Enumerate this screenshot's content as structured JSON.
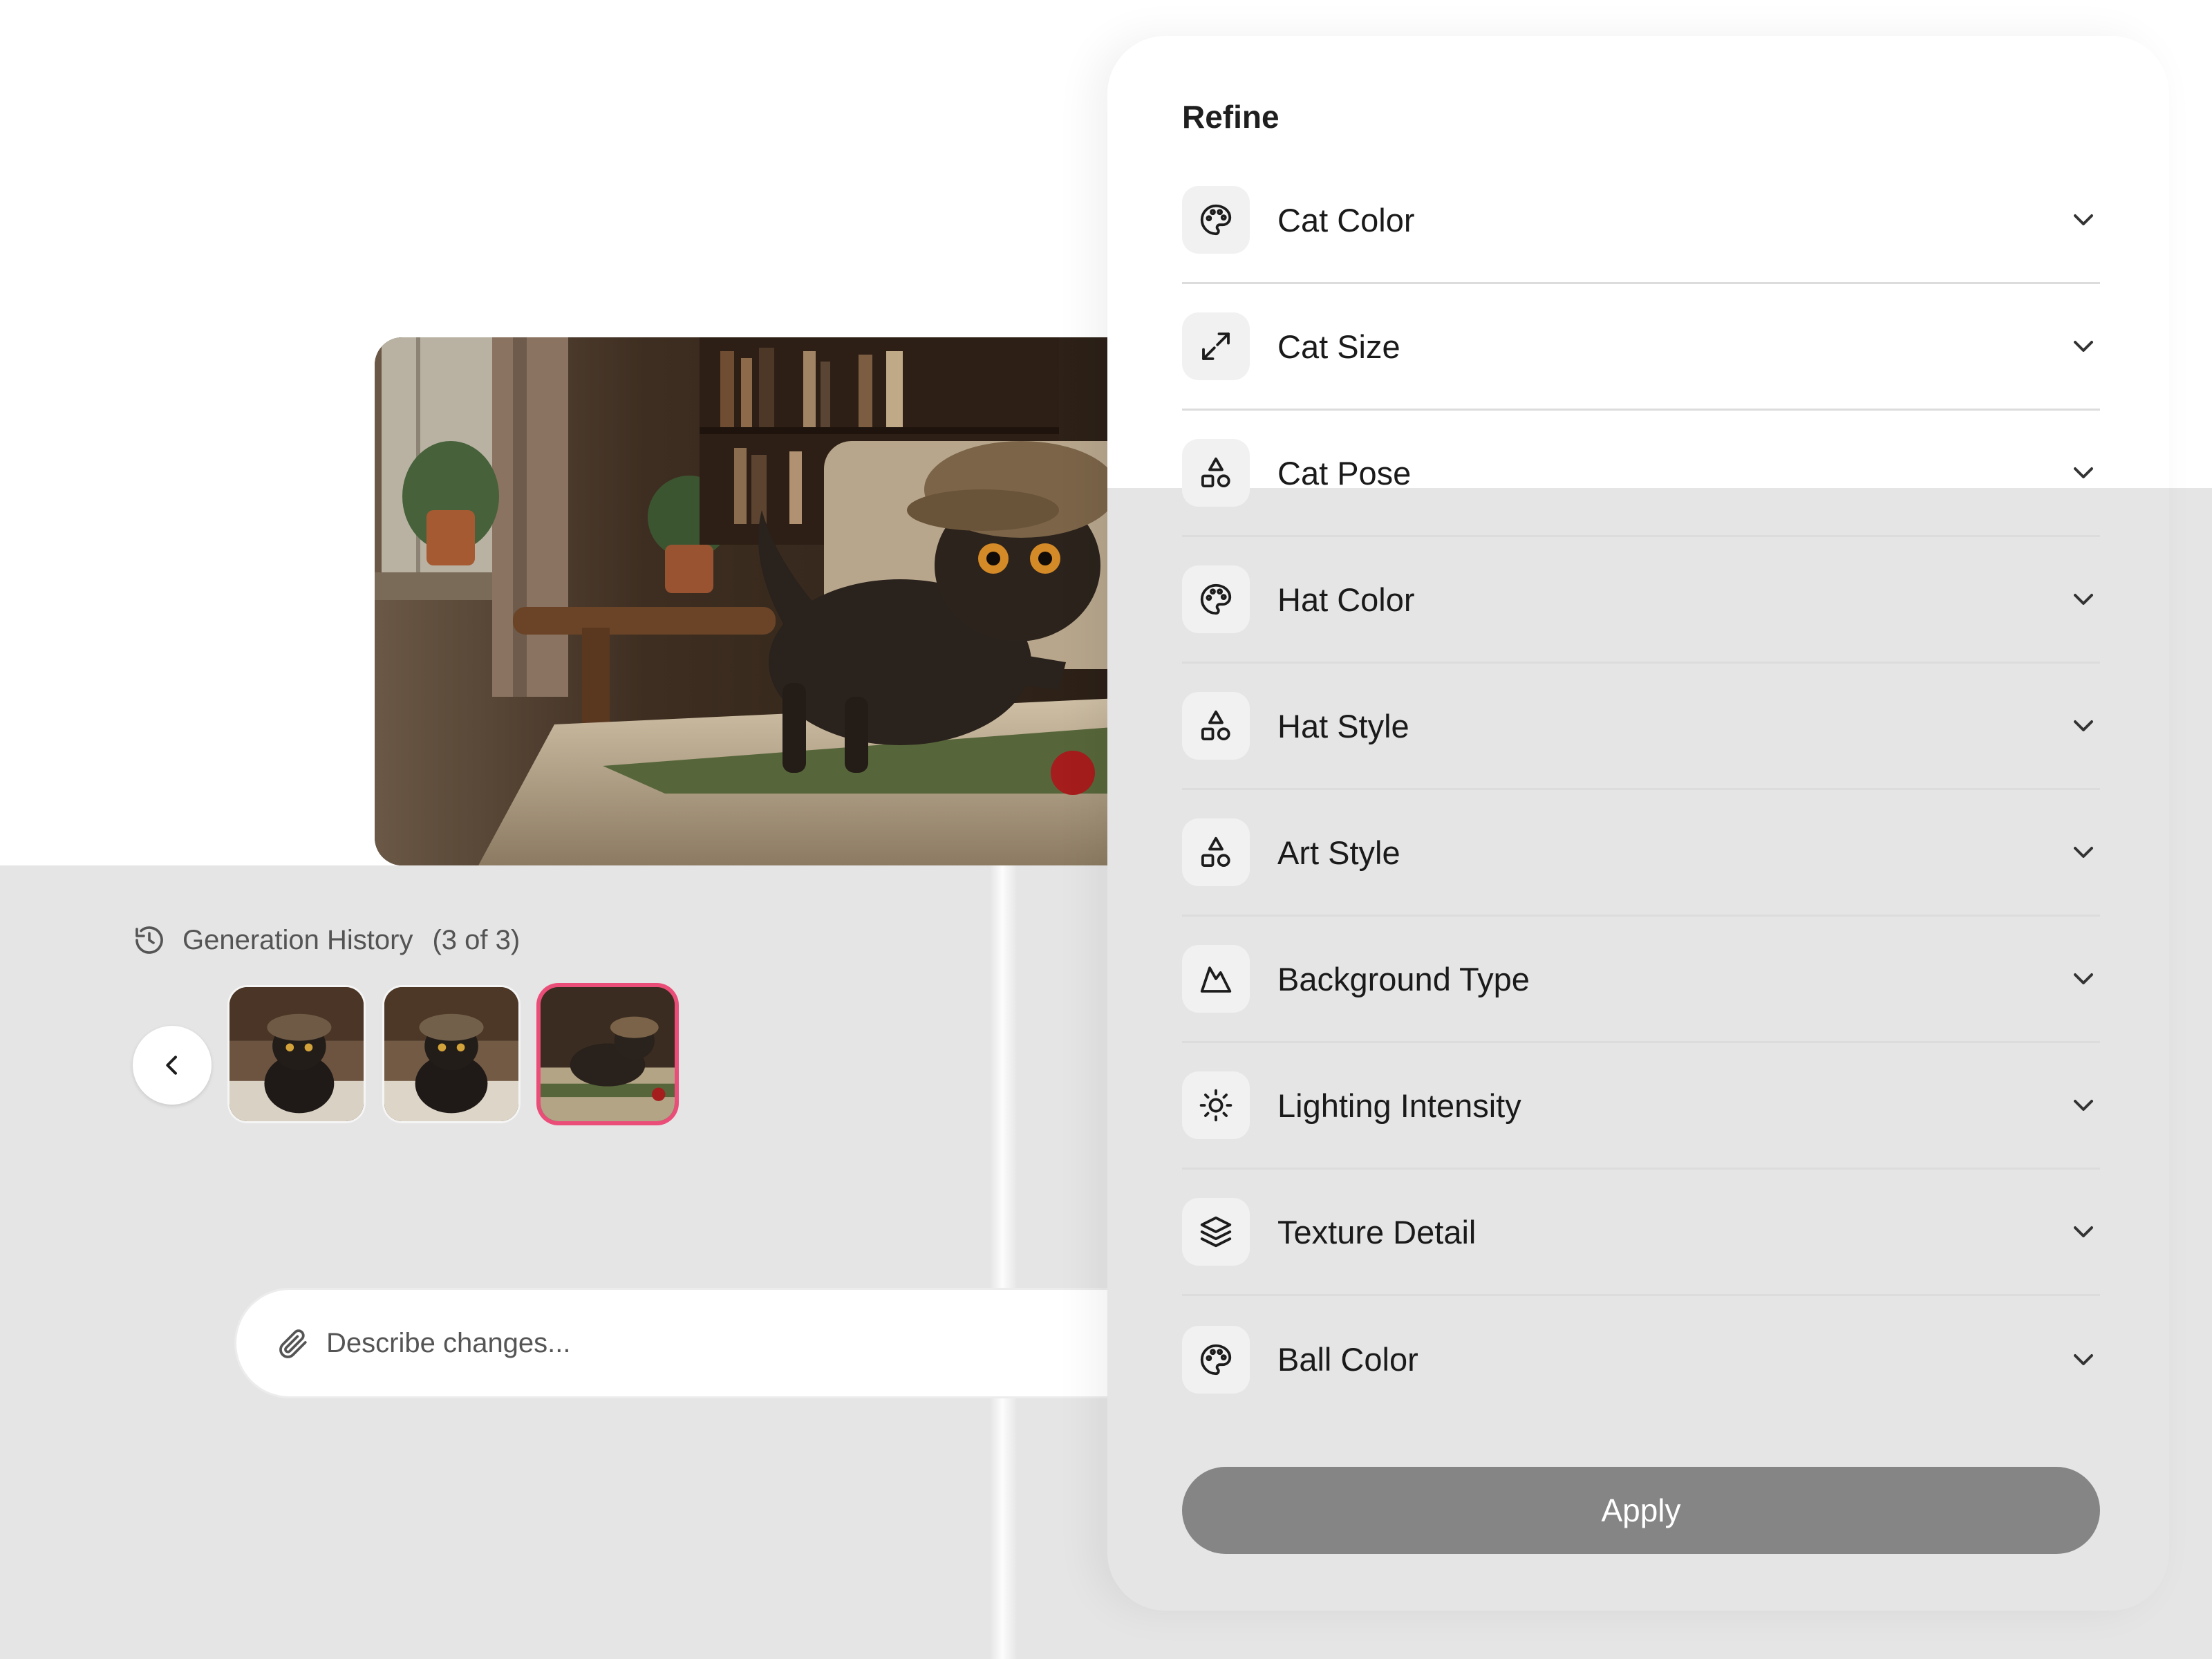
{
  "refine": {
    "title": "Refine",
    "options": [
      {
        "label": "Cat Color",
        "icon": "palette-icon"
      },
      {
        "label": "Cat Size",
        "icon": "expand-icon"
      },
      {
        "label": "Cat Pose",
        "icon": "shapes-icon"
      },
      {
        "label": "Hat Color",
        "icon": "palette-icon"
      },
      {
        "label": "Hat Style",
        "icon": "shapes-icon"
      },
      {
        "label": "Art Style",
        "icon": "shapes-icon"
      },
      {
        "label": "Background Type",
        "icon": "mountain-icon"
      },
      {
        "label": "Lighting Intensity",
        "icon": "sun-icon"
      },
      {
        "label": "Texture Detail",
        "icon": "layers-icon"
      },
      {
        "label": "Ball Color",
        "icon": "palette-icon"
      }
    ],
    "apply_label": "Apply"
  },
  "history": {
    "title": "Generation History",
    "count": "(3 of 3)",
    "selected_index": 3
  },
  "prompt": {
    "placeholder": "Describe changes..."
  },
  "colors": {
    "selected_border": "#ea4d78",
    "apply_bg": "#858585",
    "overlay": "#e5e5e5"
  }
}
